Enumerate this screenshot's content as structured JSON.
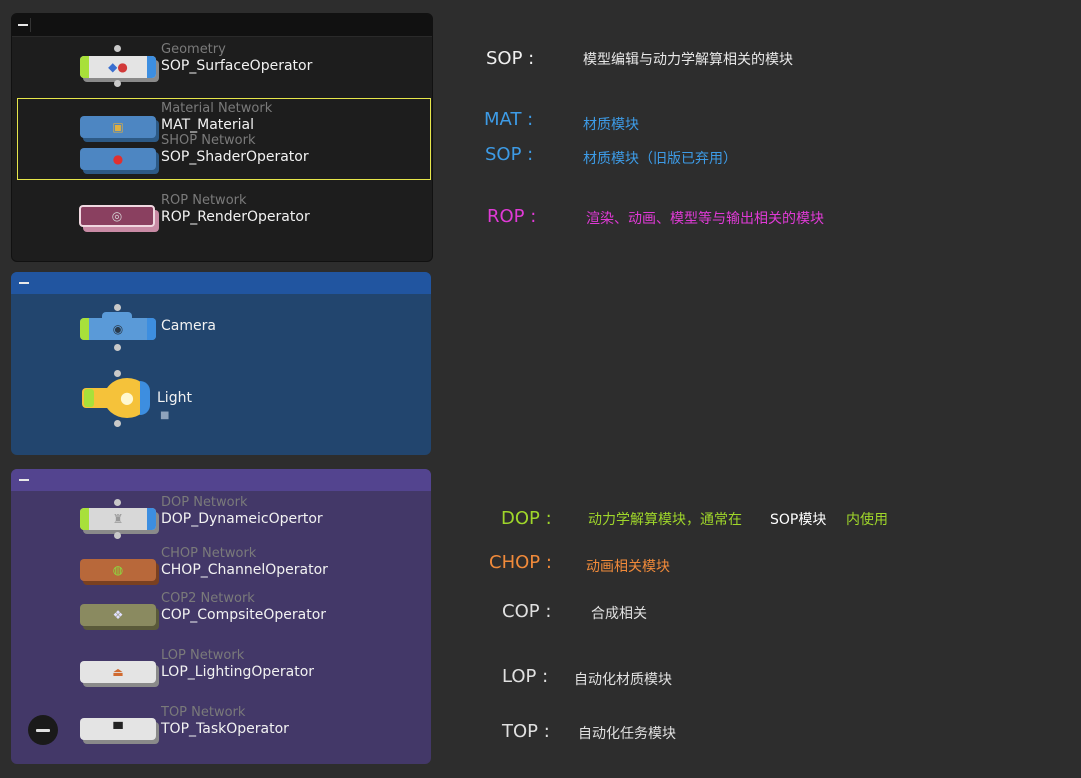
{
  "boxes": {
    "render": {
      "nodes": [
        {
          "type": "Geometry",
          "name": "SOP_SurfaceOperator",
          "icon_name": "geometry-icon"
        },
        {
          "type": "Material Network",
          "name": "MAT_Material",
          "icon_name": "material-icon"
        },
        {
          "type": "SHOP Network",
          "name": "SOP_ShaderOperator",
          "icon_name": "shader-icon"
        },
        {
          "type": "ROP Network",
          "name": "ROP_RenderOperator",
          "icon_name": "render-icon"
        }
      ]
    },
    "scene": {
      "nodes": [
        {
          "type": "",
          "name": "Camera",
          "icon_name": "camera-icon"
        },
        {
          "type": "",
          "name": "Light",
          "icon_name": "light-bulb-icon"
        }
      ]
    },
    "dynamics": {
      "nodes": [
        {
          "type": "DOP Network",
          "name": "DOP_DynameicOpertor",
          "icon_name": "dop-icon"
        },
        {
          "type": "CHOP Network",
          "name": "CHOP_ChannelOperator",
          "icon_name": "chop-wave-icon"
        },
        {
          "type": "COP2 Network",
          "name": "COP_CompsiteOperator",
          "icon_name": "cop-icon"
        },
        {
          "type": "LOP Network",
          "name": "LOP_LightingOperator",
          "icon_name": "lop-icon"
        },
        {
          "type": "TOP Network",
          "name": "TOP_TaskOperator",
          "icon_name": "top-hat-icon"
        }
      ]
    }
  },
  "annotations": {
    "sop": {
      "key": "SOP :",
      "desc": "模型编辑与动力学解算相关的模块",
      "color": "#f0f0f0"
    },
    "mat": {
      "key": "MAT :",
      "desc": "材质模块",
      "color": "#3d9be6"
    },
    "shop": {
      "key": "SOP :",
      "desc": "材质模块（旧版已弃用）",
      "color": "#3d9be6"
    },
    "rop": {
      "key": "ROP :",
      "desc": "渲染、动画、模型等与输出相关的模块",
      "color": "#e03ad6"
    },
    "dop": {
      "key": "DOP :",
      "desc_a": "动力学解算模块，通常在",
      "desc_b": "SOP模块",
      "desc_c": "内使用",
      "color": "#9fd62a"
    },
    "chop": {
      "key": "CHOP :",
      "desc": "动画相关模块",
      "color": "#f08a3a"
    },
    "cop": {
      "key": "COP :",
      "desc": "合成相关",
      "color": "#e0e0e0"
    },
    "lop": {
      "key": "LOP :",
      "desc": "自动化材质模块",
      "color": "#e0e0e0"
    },
    "top": {
      "key": "TOP :",
      "desc": "自动化任务模块",
      "color": "#e0e0e0"
    }
  },
  "colors": {
    "render_box": "#1d1d1d",
    "scene_box": "#22456e",
    "dynamics_box": "#433868",
    "selection": "#e6e64a"
  }
}
